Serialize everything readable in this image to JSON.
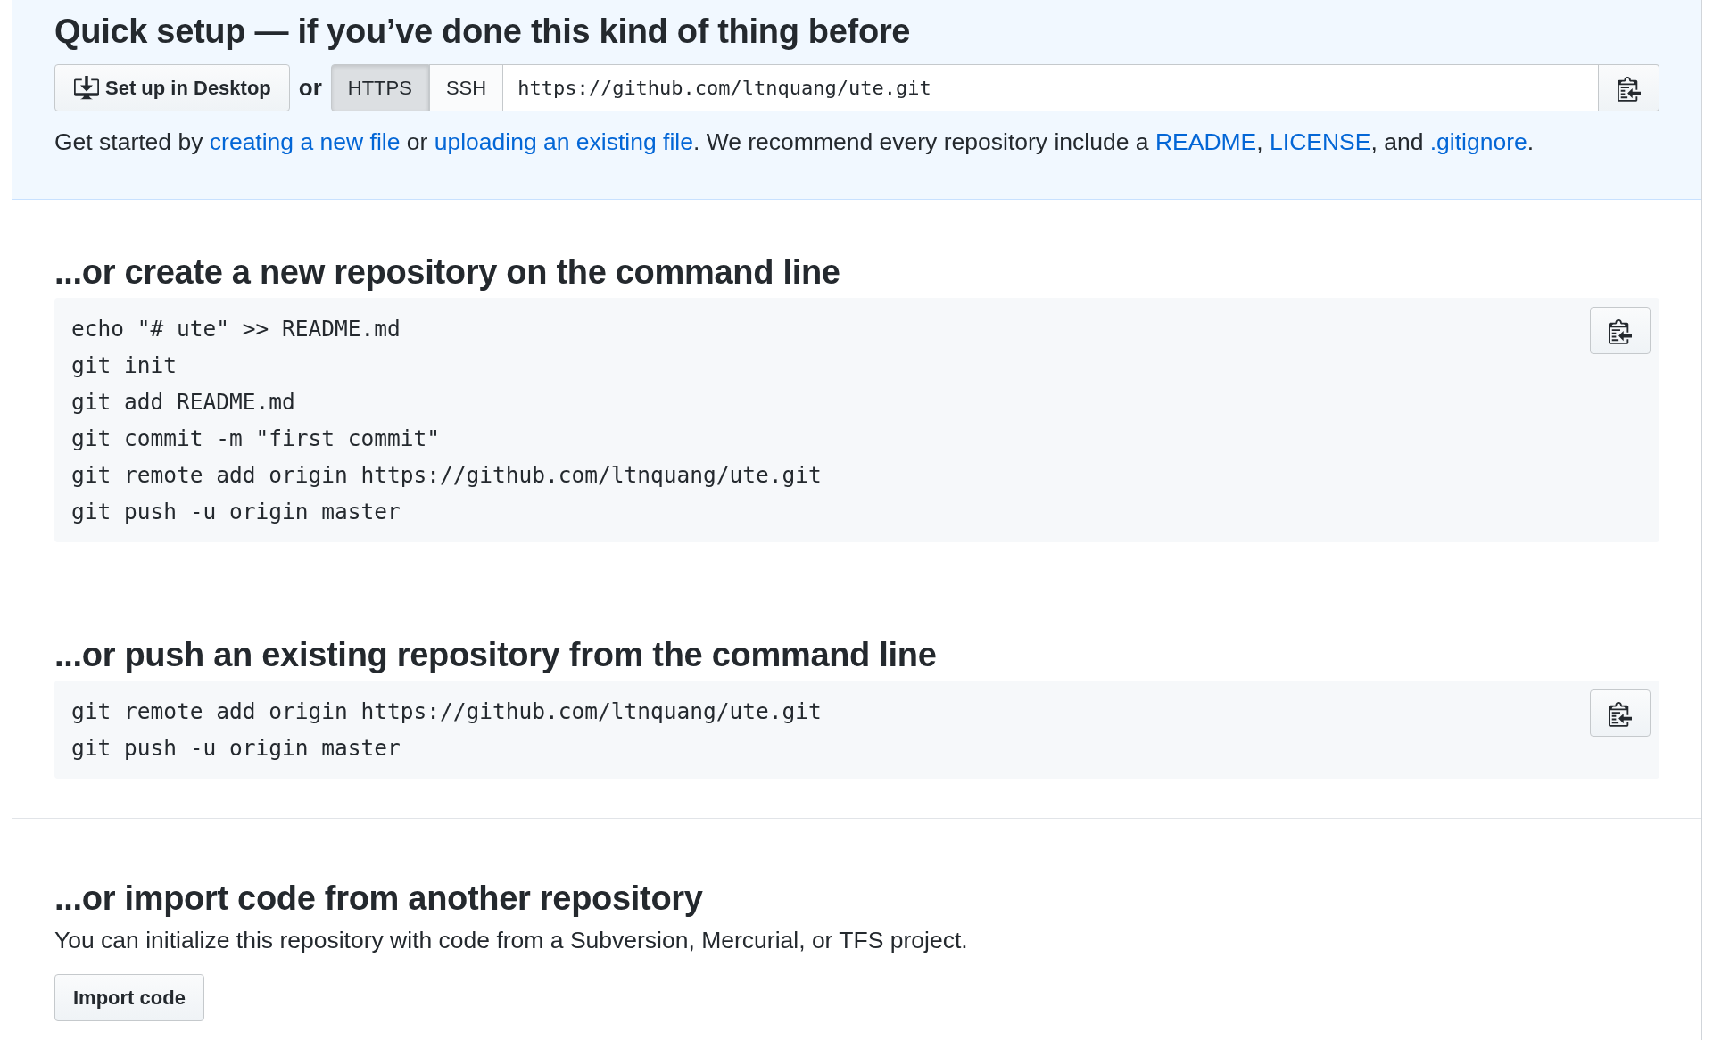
{
  "quick_setup": {
    "title": "Quick setup — if you’ve done this kind of thing before",
    "desktop_button": "Set up in Desktop",
    "or_text": "or",
    "protocols": [
      {
        "label": "HTTPS",
        "selected": true
      },
      {
        "label": "SSH",
        "selected": false
      }
    ],
    "url": "https://github.com/ltnquang/ute.git",
    "description": [
      {
        "kind": "text",
        "text": "Get started by "
      },
      {
        "kind": "link",
        "text": "creating a new file"
      },
      {
        "kind": "text",
        "text": " or "
      },
      {
        "kind": "link",
        "text": "uploading an existing file"
      },
      {
        "kind": "text",
        "text": ". We recommend every repository include a "
      },
      {
        "kind": "link",
        "text": "README"
      },
      {
        "kind": "text",
        "text": ", "
      },
      {
        "kind": "link",
        "text": "LICENSE"
      },
      {
        "kind": "text",
        "text": ", and "
      },
      {
        "kind": "link",
        "text": ".gitignore"
      },
      {
        "kind": "text",
        "text": "."
      }
    ]
  },
  "sections": [
    {
      "heading": "...or create a new repository on the command line",
      "code_lines": [
        "echo \"# ute\" >> README.md",
        "git init",
        "git add README.md",
        "git commit -m \"first commit\"",
        "git remote add origin https://github.com/ltnquang/ute.git",
        "git push -u origin master"
      ]
    },
    {
      "heading": "...or push an existing repository from the command line",
      "code_lines": [
        "git remote add origin https://github.com/ltnquang/ute.git",
        "git push -u origin master"
      ]
    }
  ],
  "import": {
    "heading": "...or import code from another repository",
    "description": "You can initialize this repository with code from a Subversion, Mercurial, or TFS project.",
    "button": "Import code"
  }
}
